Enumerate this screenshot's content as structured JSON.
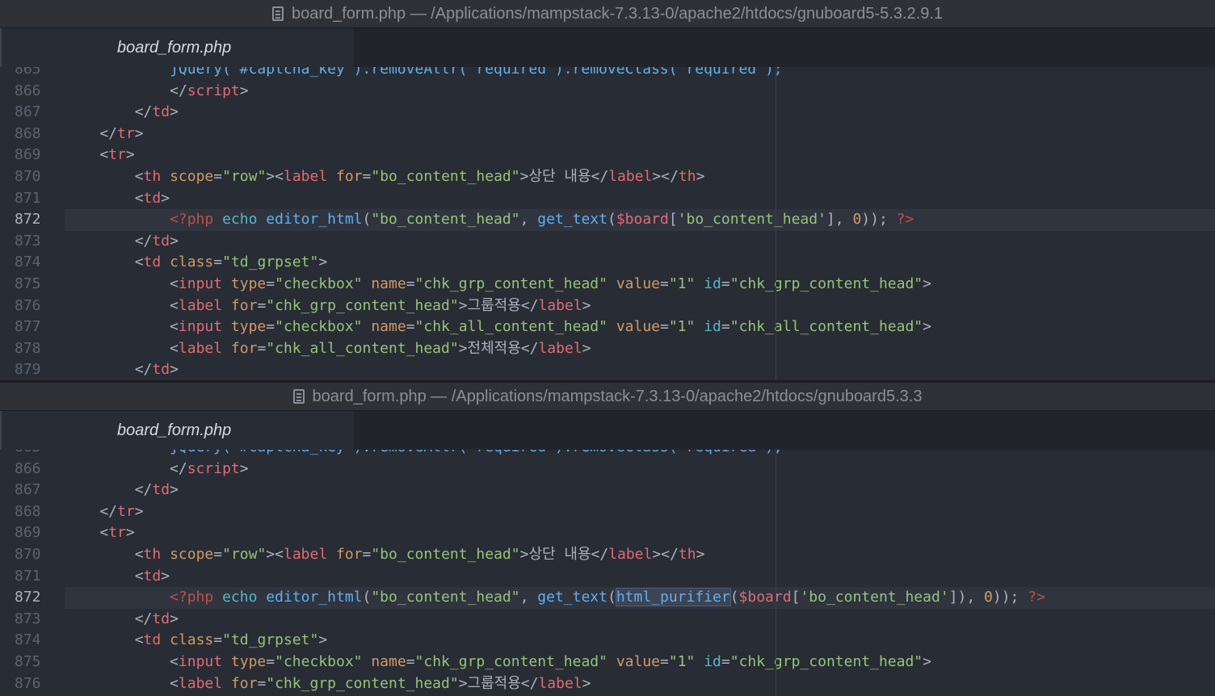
{
  "panes": [
    {
      "title": "board_form.php — /Applications/mampstack-7.3.13-0/apache2/htdocs/gnuboard5-5.3.2.9.1",
      "icon": "file-icon",
      "tab": "board_form.php",
      "active_line": "872",
      "lines": [
        {
          "n": "865",
          "tokens": [
            [
              "            ",
              "txt"
            ],
            [
              "jQuery(\"#captcha_key\").removeAttr(\"required\").removeClass(\"required\");",
              "fn"
            ]
          ]
        },
        {
          "n": "866",
          "tokens": [
            [
              "            </",
              "txt"
            ],
            [
              "script",
              "tag"
            ],
            [
              ">",
              "txt"
            ]
          ]
        },
        {
          "n": "867",
          "tokens": [
            [
              "        </",
              "txt"
            ],
            [
              "td",
              "tag"
            ],
            [
              ">",
              "txt"
            ]
          ]
        },
        {
          "n": "868",
          "tokens": [
            [
              "    </",
              "txt"
            ],
            [
              "tr",
              "tag"
            ],
            [
              ">",
              "txt"
            ]
          ]
        },
        {
          "n": "869",
          "tokens": [
            [
              "    <",
              "txt"
            ],
            [
              "tr",
              "tag"
            ],
            [
              ">",
              "txt"
            ]
          ]
        },
        {
          "n": "870",
          "tokens": [
            [
              "        <",
              "txt"
            ],
            [
              "th",
              "tag"
            ],
            [
              " ",
              "txt"
            ],
            [
              "scope",
              "attr"
            ],
            [
              "=",
              "txt"
            ],
            [
              "\"row\"",
              "str"
            ],
            [
              "><",
              "txt"
            ],
            [
              "label",
              "tag"
            ],
            [
              " ",
              "txt"
            ],
            [
              "for",
              "attr"
            ],
            [
              "=",
              "txt"
            ],
            [
              "\"bo_content_head\"",
              "str"
            ],
            [
              ">상단 내용</",
              "txt"
            ],
            [
              "label",
              "tag"
            ],
            [
              "></",
              "txt"
            ],
            [
              "th",
              "tag"
            ],
            [
              ">",
              "txt"
            ]
          ]
        },
        {
          "n": "871",
          "tokens": [
            [
              "        <",
              "txt"
            ],
            [
              "td",
              "tag"
            ],
            [
              ">",
              "txt"
            ]
          ]
        },
        {
          "n": "872",
          "tokens": [
            [
              "            ",
              "txt"
            ],
            [
              "<?php",
              "php"
            ],
            [
              " ",
              "txt"
            ],
            [
              "echo",
              "kw"
            ],
            [
              " ",
              "txt"
            ],
            [
              "editor_html",
              "fn"
            ],
            [
              "(",
              "txt"
            ],
            [
              "\"bo_content_head\"",
              "str"
            ],
            [
              ", ",
              "txt"
            ],
            [
              "get_text",
              "fn"
            ],
            [
              "(",
              "txt"
            ],
            [
              "$board",
              "var"
            ],
            [
              "[",
              "txt"
            ],
            [
              "'bo_content_head'",
              "str"
            ],
            [
              "], ",
              "txt"
            ],
            [
              "0",
              "num"
            ],
            [
              "));",
              "txt"
            ],
            [
              " ",
              "txt"
            ],
            [
              "?>",
              "php"
            ]
          ]
        },
        {
          "n": "873",
          "tokens": [
            [
              "        </",
              "txt"
            ],
            [
              "td",
              "tag"
            ],
            [
              ">",
              "txt"
            ]
          ]
        },
        {
          "n": "874",
          "tokens": [
            [
              "        <",
              "txt"
            ],
            [
              "td",
              "tag"
            ],
            [
              " ",
              "txt"
            ],
            [
              "class",
              "attr"
            ],
            [
              "=",
              "txt"
            ],
            [
              "\"td_grpset\"",
              "str"
            ],
            [
              ">",
              "txt"
            ]
          ]
        },
        {
          "n": "875",
          "tokens": [
            [
              "            <",
              "txt"
            ],
            [
              "input",
              "tag"
            ],
            [
              " ",
              "txt"
            ],
            [
              "type",
              "attr"
            ],
            [
              "=",
              "txt"
            ],
            [
              "\"checkbox\"",
              "str"
            ],
            [
              " ",
              "txt"
            ],
            [
              "name",
              "attr"
            ],
            [
              "=",
              "txt"
            ],
            [
              "\"chk_grp_content_head\"",
              "str"
            ],
            [
              " ",
              "txt"
            ],
            [
              "value",
              "attr"
            ],
            [
              "=",
              "txt"
            ],
            [
              "\"1\"",
              "str"
            ],
            [
              " ",
              "txt"
            ],
            [
              "id",
              "kw"
            ],
            [
              "=",
              "txt"
            ],
            [
              "\"chk_grp_content_head\"",
              "str"
            ],
            [
              ">",
              "txt"
            ]
          ]
        },
        {
          "n": "876",
          "tokens": [
            [
              "            <",
              "txt"
            ],
            [
              "label",
              "tag"
            ],
            [
              " ",
              "txt"
            ],
            [
              "for",
              "attr"
            ],
            [
              "=",
              "txt"
            ],
            [
              "\"chk_grp_content_head\"",
              "str"
            ],
            [
              ">그룹적용</",
              "txt"
            ],
            [
              "label",
              "tag"
            ],
            [
              ">",
              "txt"
            ]
          ]
        },
        {
          "n": "877",
          "tokens": [
            [
              "            <",
              "txt"
            ],
            [
              "input",
              "tag"
            ],
            [
              " ",
              "txt"
            ],
            [
              "type",
              "attr"
            ],
            [
              "=",
              "txt"
            ],
            [
              "\"checkbox\"",
              "str"
            ],
            [
              " ",
              "txt"
            ],
            [
              "name",
              "attr"
            ],
            [
              "=",
              "txt"
            ],
            [
              "\"chk_all_content_head\"",
              "str"
            ],
            [
              " ",
              "txt"
            ],
            [
              "value",
              "attr"
            ],
            [
              "=",
              "txt"
            ],
            [
              "\"1\"",
              "str"
            ],
            [
              " ",
              "txt"
            ],
            [
              "id",
              "kw"
            ],
            [
              "=",
              "txt"
            ],
            [
              "\"chk_all_content_head\"",
              "str"
            ],
            [
              ">",
              "txt"
            ]
          ]
        },
        {
          "n": "878",
          "tokens": [
            [
              "            <",
              "txt"
            ],
            [
              "label",
              "tag"
            ],
            [
              " ",
              "txt"
            ],
            [
              "for",
              "attr"
            ],
            [
              "=",
              "txt"
            ],
            [
              "\"chk_all_content_head\"",
              "str"
            ],
            [
              ">전체적용</",
              "txt"
            ],
            [
              "label",
              "tag"
            ],
            [
              ">",
              "txt"
            ]
          ]
        },
        {
          "n": "879",
          "tokens": [
            [
              "        </",
              "txt"
            ],
            [
              "td",
              "tag"
            ],
            [
              ">",
              "txt"
            ]
          ]
        }
      ]
    },
    {
      "title": "board_form.php — /Applications/mampstack-7.3.13-0/apache2/htdocs/gnuboard5.3.3",
      "icon": "file-icon",
      "tab": "board_form.php",
      "active_line": "872",
      "lines": [
        {
          "n": "865",
          "tokens": [
            [
              "            ",
              "txt"
            ],
            [
              "jQuery(\"#captcha_key\").removeAttr(\"required\").removeClass(\"required\");",
              "fn"
            ]
          ]
        },
        {
          "n": "866",
          "tokens": [
            [
              "            </",
              "txt"
            ],
            [
              "script",
              "tag"
            ],
            [
              ">",
              "txt"
            ]
          ]
        },
        {
          "n": "867",
          "tokens": [
            [
              "        </",
              "txt"
            ],
            [
              "td",
              "tag"
            ],
            [
              ">",
              "txt"
            ]
          ]
        },
        {
          "n": "868",
          "tokens": [
            [
              "    </",
              "txt"
            ],
            [
              "tr",
              "tag"
            ],
            [
              ">",
              "txt"
            ]
          ]
        },
        {
          "n": "869",
          "tokens": [
            [
              "    <",
              "txt"
            ],
            [
              "tr",
              "tag"
            ],
            [
              ">",
              "txt"
            ]
          ]
        },
        {
          "n": "870",
          "tokens": [
            [
              "        <",
              "txt"
            ],
            [
              "th",
              "tag"
            ],
            [
              " ",
              "txt"
            ],
            [
              "scope",
              "attr"
            ],
            [
              "=",
              "txt"
            ],
            [
              "\"row\"",
              "str"
            ],
            [
              "><",
              "txt"
            ],
            [
              "label",
              "tag"
            ],
            [
              " ",
              "txt"
            ],
            [
              "for",
              "attr"
            ],
            [
              "=",
              "txt"
            ],
            [
              "\"bo_content_head\"",
              "str"
            ],
            [
              ">상단 내용</",
              "txt"
            ],
            [
              "label",
              "tag"
            ],
            [
              "></",
              "txt"
            ],
            [
              "th",
              "tag"
            ],
            [
              ">",
              "txt"
            ]
          ]
        },
        {
          "n": "871",
          "tokens": [
            [
              "        <",
              "txt"
            ],
            [
              "td",
              "tag"
            ],
            [
              ">",
              "txt"
            ]
          ]
        },
        {
          "n": "872",
          "tokens": [
            [
              "            ",
              "txt"
            ],
            [
              "<?php",
              "php"
            ],
            [
              " ",
              "txt"
            ],
            [
              "echo",
              "kw"
            ],
            [
              " ",
              "txt"
            ],
            [
              "editor_html",
              "fn"
            ],
            [
              "(",
              "txt"
            ],
            [
              "\"bo_content_head\"",
              "str"
            ],
            [
              ", ",
              "txt"
            ],
            [
              "get_text",
              "fn"
            ],
            [
              "(",
              "txt"
            ],
            [
              "html_purifier",
              "hl"
            ],
            [
              "(",
              "txt"
            ],
            [
              "$board",
              "var"
            ],
            [
              "[",
              "txt"
            ],
            [
              "'bo_content_head'",
              "str"
            ],
            [
              "]), ",
              "txt"
            ],
            [
              "0",
              "num"
            ],
            [
              "));",
              "txt"
            ],
            [
              " ",
              "txt"
            ],
            [
              "?>",
              "php"
            ]
          ]
        },
        {
          "n": "873",
          "tokens": [
            [
              "        </",
              "txt"
            ],
            [
              "td",
              "tag"
            ],
            [
              ">",
              "txt"
            ]
          ]
        },
        {
          "n": "874",
          "tokens": [
            [
              "        <",
              "txt"
            ],
            [
              "td",
              "tag"
            ],
            [
              " ",
              "txt"
            ],
            [
              "class",
              "attr"
            ],
            [
              "=",
              "txt"
            ],
            [
              "\"td_grpset\"",
              "str"
            ],
            [
              ">",
              "txt"
            ]
          ]
        },
        {
          "n": "875",
          "tokens": [
            [
              "            <",
              "txt"
            ],
            [
              "input",
              "tag"
            ],
            [
              " ",
              "txt"
            ],
            [
              "type",
              "attr"
            ],
            [
              "=",
              "txt"
            ],
            [
              "\"checkbox\"",
              "str"
            ],
            [
              " ",
              "txt"
            ],
            [
              "name",
              "attr"
            ],
            [
              "=",
              "txt"
            ],
            [
              "\"chk_grp_content_head\"",
              "str"
            ],
            [
              " ",
              "txt"
            ],
            [
              "value",
              "attr"
            ],
            [
              "=",
              "txt"
            ],
            [
              "\"1\"",
              "str"
            ],
            [
              " ",
              "txt"
            ],
            [
              "id",
              "kw"
            ],
            [
              "=",
              "txt"
            ],
            [
              "\"chk_grp_content_head\"",
              "str"
            ],
            [
              ">",
              "txt"
            ]
          ]
        },
        {
          "n": "876",
          "tokens": [
            [
              "            <",
              "txt"
            ],
            [
              "label",
              "tag"
            ],
            [
              " ",
              "txt"
            ],
            [
              "for",
              "attr"
            ],
            [
              "=",
              "txt"
            ],
            [
              "\"chk_grp_content_head\"",
              "str"
            ],
            [
              ">그룹적용</",
              "txt"
            ],
            [
              "label",
              "tag"
            ],
            [
              ">",
              "txt"
            ]
          ]
        }
      ]
    }
  ]
}
